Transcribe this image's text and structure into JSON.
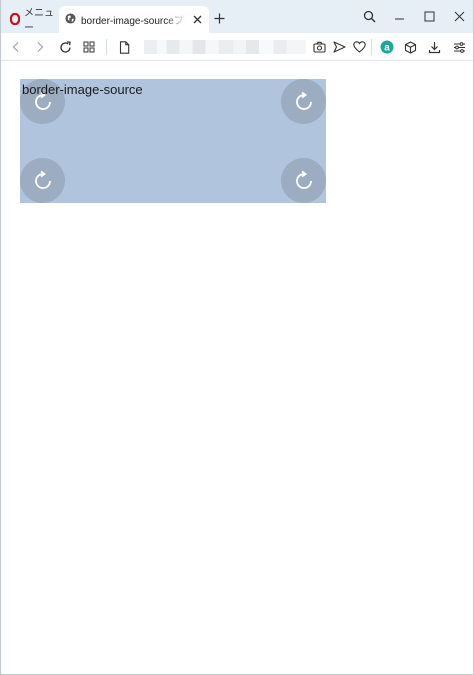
{
  "browser": {
    "menu_tab_label": "メニュー",
    "active_tab_title": "border-image-sourceプロパティ",
    "new_tab_symbol": "+",
    "accent_color": "#cc0f16"
  },
  "toolbar": {
    "icons": [
      "back-icon",
      "forward-icon",
      "reload-icon",
      "speed-dial-icon",
      "page-icon",
      "camera-icon",
      "send-icon",
      "heart-icon",
      "extension-a-icon",
      "cube-icon",
      "download-icon",
      "easy-setup-icon"
    ]
  },
  "page": {
    "demo_text": "border-image-source",
    "box_color": "#b0c4de"
  }
}
